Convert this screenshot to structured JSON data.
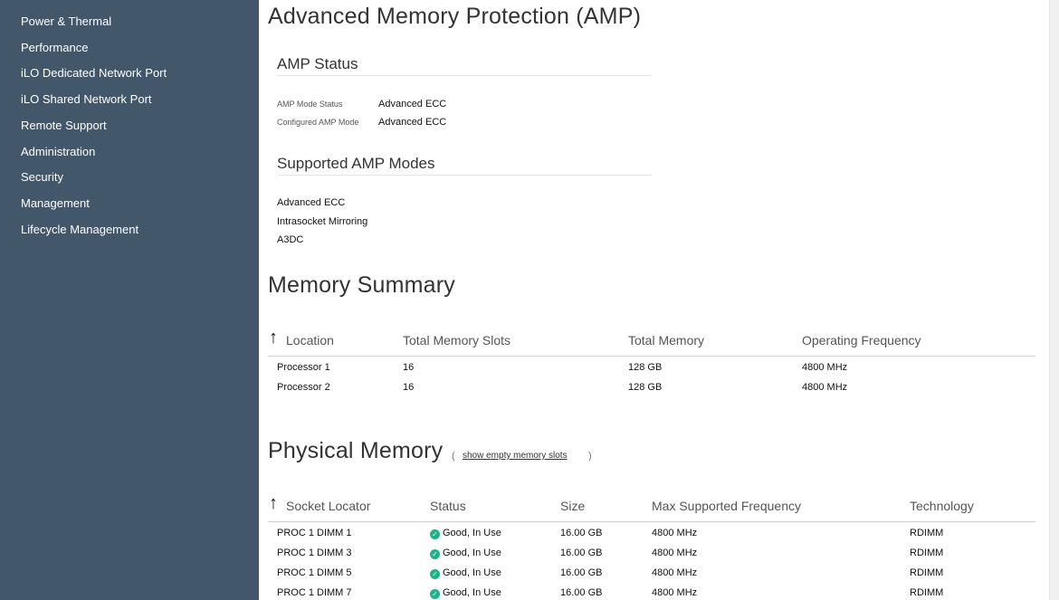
{
  "sidebar": {
    "items": [
      {
        "label": "Power & Thermal"
      },
      {
        "label": "Performance"
      },
      {
        "label": "iLO Dedicated Network Port"
      },
      {
        "label": "iLO Shared Network Port"
      },
      {
        "label": "Remote Support"
      },
      {
        "label": "Administration"
      },
      {
        "label": "Security"
      },
      {
        "label": "Management"
      },
      {
        "label": "Lifecycle Management"
      }
    ]
  },
  "amp": {
    "title": "Advanced Memory Protection (AMP)",
    "status_heading": "AMP Status",
    "mode_status_label": "AMP Mode Status",
    "mode_status_value": "Advanced ECC",
    "configured_label": "Configured AMP Mode",
    "configured_value": "Advanced ECC",
    "supported_heading": "Supported AMP Modes",
    "supported_modes": [
      "Advanced ECC",
      "Intrasocket Mirroring",
      "A3DC"
    ]
  },
  "memory_summary": {
    "title": "Memory Summary",
    "columns": [
      "Location",
      "Total Memory Slots",
      "Total Memory",
      "Operating Frequency"
    ],
    "rows": [
      [
        "Processor 1",
        "16",
        "128 GB",
        "4800 MHz"
      ],
      [
        "Processor 2",
        "16",
        "128 GB",
        "4800 MHz"
      ]
    ]
  },
  "physical_memory": {
    "title": "Physical Memory",
    "link_open": "(",
    "link_label": "show empty memory slots",
    "link_close": ")",
    "columns": [
      "Socket Locator",
      "Status",
      "Size",
      "Max Supported Frequency",
      "Technology"
    ],
    "rows": [
      [
        "PROC 1 DIMM 1",
        "Good, In Use",
        "16.00 GB",
        "4800 MHz",
        "RDIMM"
      ],
      [
        "PROC 1 DIMM 3",
        "Good, In Use",
        "16.00 GB",
        "4800 MHz",
        "RDIMM"
      ],
      [
        "PROC 1 DIMM 5",
        "Good, In Use",
        "16.00 GB",
        "4800 MHz",
        "RDIMM"
      ],
      [
        "PROC 1 DIMM 7",
        "Good, In Use",
        "16.00 GB",
        "4800 MHz",
        "RDIMM"
      ]
    ]
  },
  "colors": {
    "sidebar_bg": "#43576a",
    "status_ok": "#1bb38a"
  }
}
